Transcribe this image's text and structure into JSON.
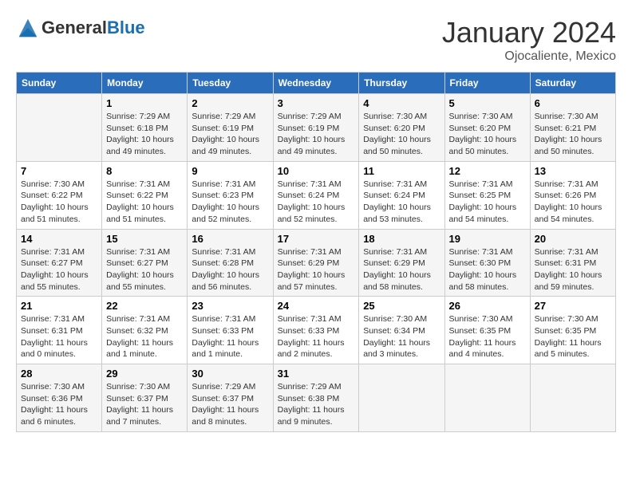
{
  "logo": {
    "text_general": "General",
    "text_blue": "Blue"
  },
  "header": {
    "month": "January 2024",
    "location": "Ojocaliente, Mexico"
  },
  "days_of_week": [
    "Sunday",
    "Monday",
    "Tuesday",
    "Wednesday",
    "Thursday",
    "Friday",
    "Saturday"
  ],
  "weeks": [
    [
      {
        "date": "",
        "sunrise": "",
        "sunset": "",
        "daylight": ""
      },
      {
        "date": "1",
        "sunrise": "Sunrise: 7:29 AM",
        "sunset": "Sunset: 6:18 PM",
        "daylight": "Daylight: 10 hours and 49 minutes."
      },
      {
        "date": "2",
        "sunrise": "Sunrise: 7:29 AM",
        "sunset": "Sunset: 6:19 PM",
        "daylight": "Daylight: 10 hours and 49 minutes."
      },
      {
        "date": "3",
        "sunrise": "Sunrise: 7:29 AM",
        "sunset": "Sunset: 6:19 PM",
        "daylight": "Daylight: 10 hours and 49 minutes."
      },
      {
        "date": "4",
        "sunrise": "Sunrise: 7:30 AM",
        "sunset": "Sunset: 6:20 PM",
        "daylight": "Daylight: 10 hours and 50 minutes."
      },
      {
        "date": "5",
        "sunrise": "Sunrise: 7:30 AM",
        "sunset": "Sunset: 6:20 PM",
        "daylight": "Daylight: 10 hours and 50 minutes."
      },
      {
        "date": "6",
        "sunrise": "Sunrise: 7:30 AM",
        "sunset": "Sunset: 6:21 PM",
        "daylight": "Daylight: 10 hours and 50 minutes."
      }
    ],
    [
      {
        "date": "7",
        "sunrise": "Sunrise: 7:30 AM",
        "sunset": "Sunset: 6:22 PM",
        "daylight": "Daylight: 10 hours and 51 minutes."
      },
      {
        "date": "8",
        "sunrise": "Sunrise: 7:31 AM",
        "sunset": "Sunset: 6:22 PM",
        "daylight": "Daylight: 10 hours and 51 minutes."
      },
      {
        "date": "9",
        "sunrise": "Sunrise: 7:31 AM",
        "sunset": "Sunset: 6:23 PM",
        "daylight": "Daylight: 10 hours and 52 minutes."
      },
      {
        "date": "10",
        "sunrise": "Sunrise: 7:31 AM",
        "sunset": "Sunset: 6:24 PM",
        "daylight": "Daylight: 10 hours and 52 minutes."
      },
      {
        "date": "11",
        "sunrise": "Sunrise: 7:31 AM",
        "sunset": "Sunset: 6:24 PM",
        "daylight": "Daylight: 10 hours and 53 minutes."
      },
      {
        "date": "12",
        "sunrise": "Sunrise: 7:31 AM",
        "sunset": "Sunset: 6:25 PM",
        "daylight": "Daylight: 10 hours and 54 minutes."
      },
      {
        "date": "13",
        "sunrise": "Sunrise: 7:31 AM",
        "sunset": "Sunset: 6:26 PM",
        "daylight": "Daylight: 10 hours and 54 minutes."
      }
    ],
    [
      {
        "date": "14",
        "sunrise": "Sunrise: 7:31 AM",
        "sunset": "Sunset: 6:27 PM",
        "daylight": "Daylight: 10 hours and 55 minutes."
      },
      {
        "date": "15",
        "sunrise": "Sunrise: 7:31 AM",
        "sunset": "Sunset: 6:27 PM",
        "daylight": "Daylight: 10 hours and 55 minutes."
      },
      {
        "date": "16",
        "sunrise": "Sunrise: 7:31 AM",
        "sunset": "Sunset: 6:28 PM",
        "daylight": "Daylight: 10 hours and 56 minutes."
      },
      {
        "date": "17",
        "sunrise": "Sunrise: 7:31 AM",
        "sunset": "Sunset: 6:29 PM",
        "daylight": "Daylight: 10 hours and 57 minutes."
      },
      {
        "date": "18",
        "sunrise": "Sunrise: 7:31 AM",
        "sunset": "Sunset: 6:29 PM",
        "daylight": "Daylight: 10 hours and 58 minutes."
      },
      {
        "date": "19",
        "sunrise": "Sunrise: 7:31 AM",
        "sunset": "Sunset: 6:30 PM",
        "daylight": "Daylight: 10 hours and 58 minutes."
      },
      {
        "date": "20",
        "sunrise": "Sunrise: 7:31 AM",
        "sunset": "Sunset: 6:31 PM",
        "daylight": "Daylight: 10 hours and 59 minutes."
      }
    ],
    [
      {
        "date": "21",
        "sunrise": "Sunrise: 7:31 AM",
        "sunset": "Sunset: 6:31 PM",
        "daylight": "Daylight: 11 hours and 0 minutes."
      },
      {
        "date": "22",
        "sunrise": "Sunrise: 7:31 AM",
        "sunset": "Sunset: 6:32 PM",
        "daylight": "Daylight: 11 hours and 1 minute."
      },
      {
        "date": "23",
        "sunrise": "Sunrise: 7:31 AM",
        "sunset": "Sunset: 6:33 PM",
        "daylight": "Daylight: 11 hours and 1 minute."
      },
      {
        "date": "24",
        "sunrise": "Sunrise: 7:31 AM",
        "sunset": "Sunset: 6:33 PM",
        "daylight": "Daylight: 11 hours and 2 minutes."
      },
      {
        "date": "25",
        "sunrise": "Sunrise: 7:30 AM",
        "sunset": "Sunset: 6:34 PM",
        "daylight": "Daylight: 11 hours and 3 minutes."
      },
      {
        "date": "26",
        "sunrise": "Sunrise: 7:30 AM",
        "sunset": "Sunset: 6:35 PM",
        "daylight": "Daylight: 11 hours and 4 minutes."
      },
      {
        "date": "27",
        "sunrise": "Sunrise: 7:30 AM",
        "sunset": "Sunset: 6:35 PM",
        "daylight": "Daylight: 11 hours and 5 minutes."
      }
    ],
    [
      {
        "date": "28",
        "sunrise": "Sunrise: 7:30 AM",
        "sunset": "Sunset: 6:36 PM",
        "daylight": "Daylight: 11 hours and 6 minutes."
      },
      {
        "date": "29",
        "sunrise": "Sunrise: 7:30 AM",
        "sunset": "Sunset: 6:37 PM",
        "daylight": "Daylight: 11 hours and 7 minutes."
      },
      {
        "date": "30",
        "sunrise": "Sunrise: 7:29 AM",
        "sunset": "Sunset: 6:37 PM",
        "daylight": "Daylight: 11 hours and 8 minutes."
      },
      {
        "date": "31",
        "sunrise": "Sunrise: 7:29 AM",
        "sunset": "Sunset: 6:38 PM",
        "daylight": "Daylight: 11 hours and 9 minutes."
      },
      {
        "date": "",
        "sunrise": "",
        "sunset": "",
        "daylight": ""
      },
      {
        "date": "",
        "sunrise": "",
        "sunset": "",
        "daylight": ""
      },
      {
        "date": "",
        "sunrise": "",
        "sunset": "",
        "daylight": ""
      }
    ]
  ]
}
